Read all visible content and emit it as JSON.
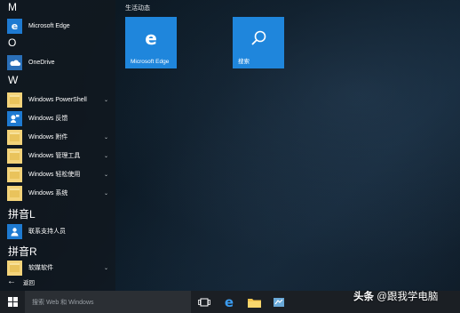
{
  "sections": {
    "m": "M",
    "o": "O",
    "w": "W",
    "pinyin_l": "拼音L",
    "pinyin_r": "拼音R"
  },
  "apps": {
    "edge": "Microsoft Edge",
    "onedrive": "OneDrive",
    "powershell": "Windows PowerShell",
    "feedback": "Windows 反馈",
    "accessories": "Windows 附件",
    "admin_tools": "Windows 管理工具",
    "ease_of_access": "Windows 轻松使用",
    "system": "Windows 系统",
    "contact_support": "联系支持人员",
    "software": "软媒软件"
  },
  "chevron": "⌄",
  "back_label": "返回",
  "tiles": {
    "group_title": "生活动态",
    "edge_label": "Microsoft Edge",
    "search_label": "搜索"
  },
  "taskbar": {
    "search_placeholder": "搜索 Web 和 Windows"
  },
  "watermark": {
    "brand": "头条",
    "handle": "@跟我学电脑"
  },
  "colors": {
    "accent": "#1f86dc",
    "folder": "#f3d37a",
    "taskbar": "#1b1f24"
  }
}
